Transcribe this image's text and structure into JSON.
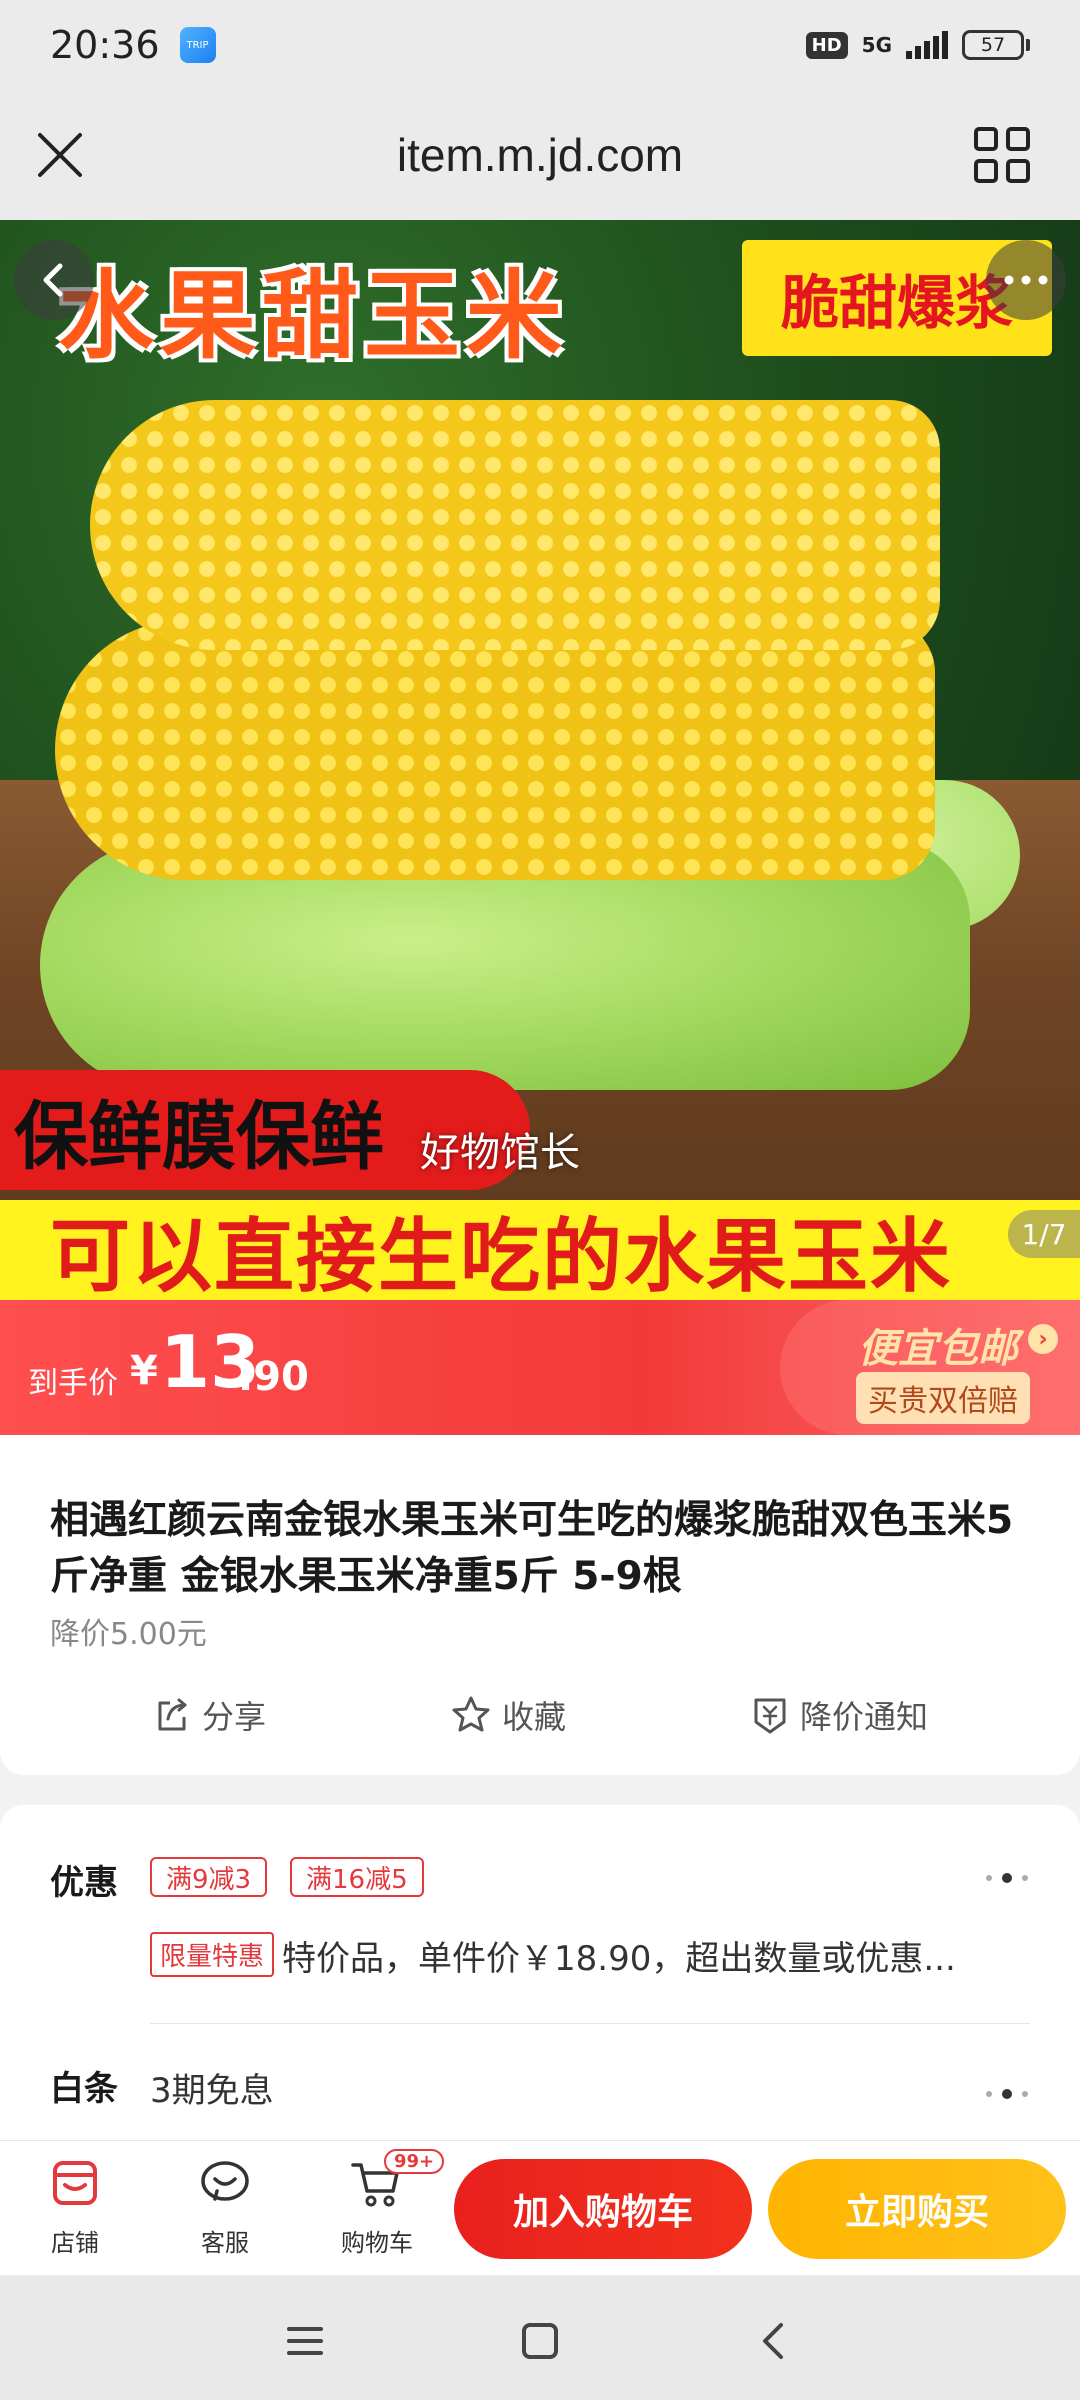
{
  "status_bar": {
    "time": "20:36",
    "app_icon_label": "TRIP",
    "hd": "HD",
    "network": "5G",
    "battery": "57"
  },
  "browser": {
    "url": "item.m.jd.com"
  },
  "hero": {
    "title": "水果甜玉米",
    "badge": "脆甜爆浆",
    "red_banner": "保鲜膜保鲜",
    "watermark": "好物馆长",
    "yellow_banner": "可以直接生吃的水果玉米",
    "page_indicator": "1/7"
  },
  "price": {
    "label": "到手价",
    "currency": "¥",
    "integer": "13",
    "decimal": ".90",
    "shipping": "便宜包邮",
    "compensate": "买贵双倍赔"
  },
  "product": {
    "title": "相遇红颜云南金银水果玉米可生吃的爆浆脆甜双色玉米5斤净重 金银水果玉米净重5斤 5-9根",
    "price_drop": "降价5.00元",
    "actions": {
      "share": "分享",
      "favorite": "收藏",
      "notify": "降价通知"
    }
  },
  "promo": {
    "title": "优惠",
    "coupons": [
      "满9减3",
      "满16减5"
    ],
    "special_tag": "限量特惠",
    "special_text": "特价品，单件价￥18.90，超出数量或优惠...",
    "baitiao_title": "白条",
    "baitiao_text": "3期免息"
  },
  "bottom_bar": {
    "store": "店铺",
    "service": "客服",
    "cart": "购物车",
    "cart_badge": "99+",
    "add_to_cart": "加入购物车",
    "buy_now": "立即购买"
  },
  "colors": {
    "jd_red": "#e4393c",
    "buy_yellow": "#ffb400",
    "price_red": "#f23a3a"
  }
}
